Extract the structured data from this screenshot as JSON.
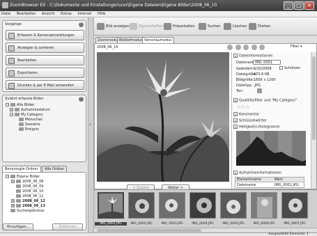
{
  "window": {
    "title": "ZoomBrowser EX  -  C:\\Dokumente und Einstellungen\\xxx\\Eigene Dateien\\Eigene Bilder\\2008_06_10"
  },
  "menu": [
    "Datei",
    "Bearbeiten",
    "Ansicht",
    "Extras",
    "Internet",
    "Hilfe"
  ],
  "tasks": {
    "header": "Vorgänge",
    "items": [
      "Erfassen & Kameraeinstellungen",
      "Anzeigen & sortieren",
      "Bearbeiten",
      "Exportieren",
      "Drucken & per E-Mail versenden"
    ]
  },
  "recent": {
    "header": "Zuletzt erfasste Bilder",
    "tree": [
      "Alle Bilder",
      "Aufnahmedatum",
      "My Category",
      "Menschen",
      "Szenerie",
      "Ereignis"
    ]
  },
  "folders": {
    "tabs": [
      "Bevorzugte Ordner",
      "Alle Ordner"
    ],
    "tree": [
      "Eigene Bilder",
      "2008_06_08",
      "2008_06_09",
      "2008_06_10",
      "2008_06_11",
      "2008_06_12",
      "2008_06_13",
      "Suchergebnisse"
    ],
    "bold": [
      false,
      false,
      false,
      false,
      false,
      true,
      true,
      false
    ],
    "add_button": "Hinzufügen...",
    "remove_button": "Entfernen"
  },
  "toolbar": {
    "view_images": "Bild anzeigen",
    "properties": "Eigenschaften",
    "presentation": "Präsentation",
    "search": "Suchen",
    "delete": "Löschen",
    "rotate": "Drehen"
  },
  "view_tabs": [
    "Zoommodus",
    "Bildliefmodus",
    "Vorschaumodus"
  ],
  "viewer": {
    "date_label": "2008_06_10",
    "filter_label": "Filter",
    "back_button": "< Zurück",
    "next_button": "Weiter >"
  },
  "info": {
    "file_section": "Dateiinformationen",
    "rows": [
      {
        "label": "Dateiname:",
        "value": "IMG_0001"
      },
      {
        "label": "Geändert:",
        "value": "6/10/2008"
      },
      {
        "label": "Dateigröße:",
        "value": "470.6 KB"
      },
      {
        "label": "Bildgröße:",
        "value": "1600 x 1200"
      },
      {
        "label": "Dateityp:",
        "value": ".JPG"
      },
      {
        "label": "Ton:",
        "value": ""
      }
    ],
    "protect_label": "Schützen",
    "quality_section": "Qualitätsfilter und \"My Category\"",
    "comment_section": "Kommentar",
    "keyword_section": "Schlüsselwörter",
    "histogram_section": "Helligkeits-Histogramm",
    "shooting_section": "Aufnahmeinformationen",
    "table_headers": [
      "Elementname",
      "Wert"
    ],
    "table_rows": [
      {
        "name": "Dateiname",
        "value": "IMG_0001.JPG"
      }
    ]
  },
  "thumbnails": [
    {
      "label": "IMG_0001.JPG",
      "selected": true
    },
    {
      "label": "IMG_0002.JPG",
      "selected": false
    },
    {
      "label": "IMG_0003.JPG",
      "selected": false
    },
    {
      "label": "IMG_0004.JPG",
      "selected": false
    },
    {
      "label": "IMG_0005.JPG",
      "selected": false
    },
    {
      "label": "IMG_0006.JPG",
      "selected": false
    },
    {
      "label": "IMG_0007.JPG",
      "selected": false
    }
  ],
  "status": {
    "text": "Ausgewählte Elemente: 1"
  }
}
